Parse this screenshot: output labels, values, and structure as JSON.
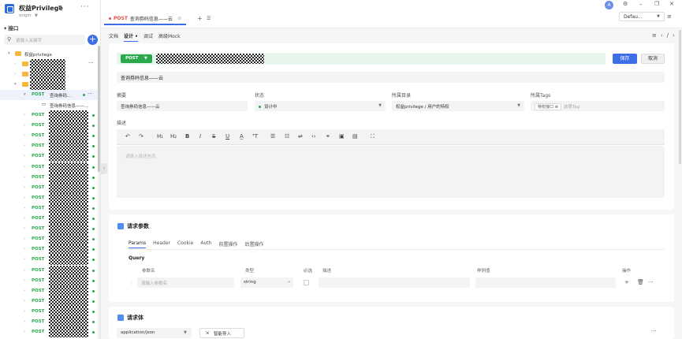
{
  "project": {
    "name": "权益Privilege",
    "branch": "origin"
  },
  "sidebar": {
    "section": "接口",
    "search_placeholder": "请输入关键字",
    "folder_root": "权益privilege",
    "selected_method": "POST",
    "selected_label": "查询券码...",
    "selected_child": "查询券码信息——...",
    "method_label": "POST"
  },
  "tab": {
    "method": "POST",
    "title": "查询券码信息——云"
  },
  "env": {
    "label": "Defau..."
  },
  "subtabs": [
    "文档",
    "设计",
    "调试",
    "高级Mock"
  ],
  "request": {
    "method": "POST",
    "name": "查询券码信息——云",
    "save": "保存",
    "cancel": "取消"
  },
  "fields": {
    "summary_label": "摘要",
    "summary_value": "查询券码信息——云",
    "status_label": "状态",
    "status_value": "设计中",
    "dir_label": "所属目录",
    "dir_value": "权益privilege / 用户的特权",
    "tags_label": "所属Tags",
    "tag_value": "特权接口",
    "tag_placeholder": "选择Tag",
    "desc_label": "描述",
    "desc_placeholder": "请输入描述信息"
  },
  "params": {
    "title": "请求参数",
    "tabs": [
      "Params",
      "Header",
      "Cookie",
      "Auth",
      "前置操作",
      "后置操作"
    ],
    "query_label": "Query",
    "headers": {
      "name": "参数名",
      "type": "类型",
      "required": "必选",
      "desc": "描述",
      "example": "样例值",
      "ops": "操作"
    },
    "name_placeholder": "请输入参数名",
    "type_value": "string"
  },
  "body": {
    "title": "请求体",
    "content_type": "application/json",
    "smart_import": "智能导入"
  }
}
